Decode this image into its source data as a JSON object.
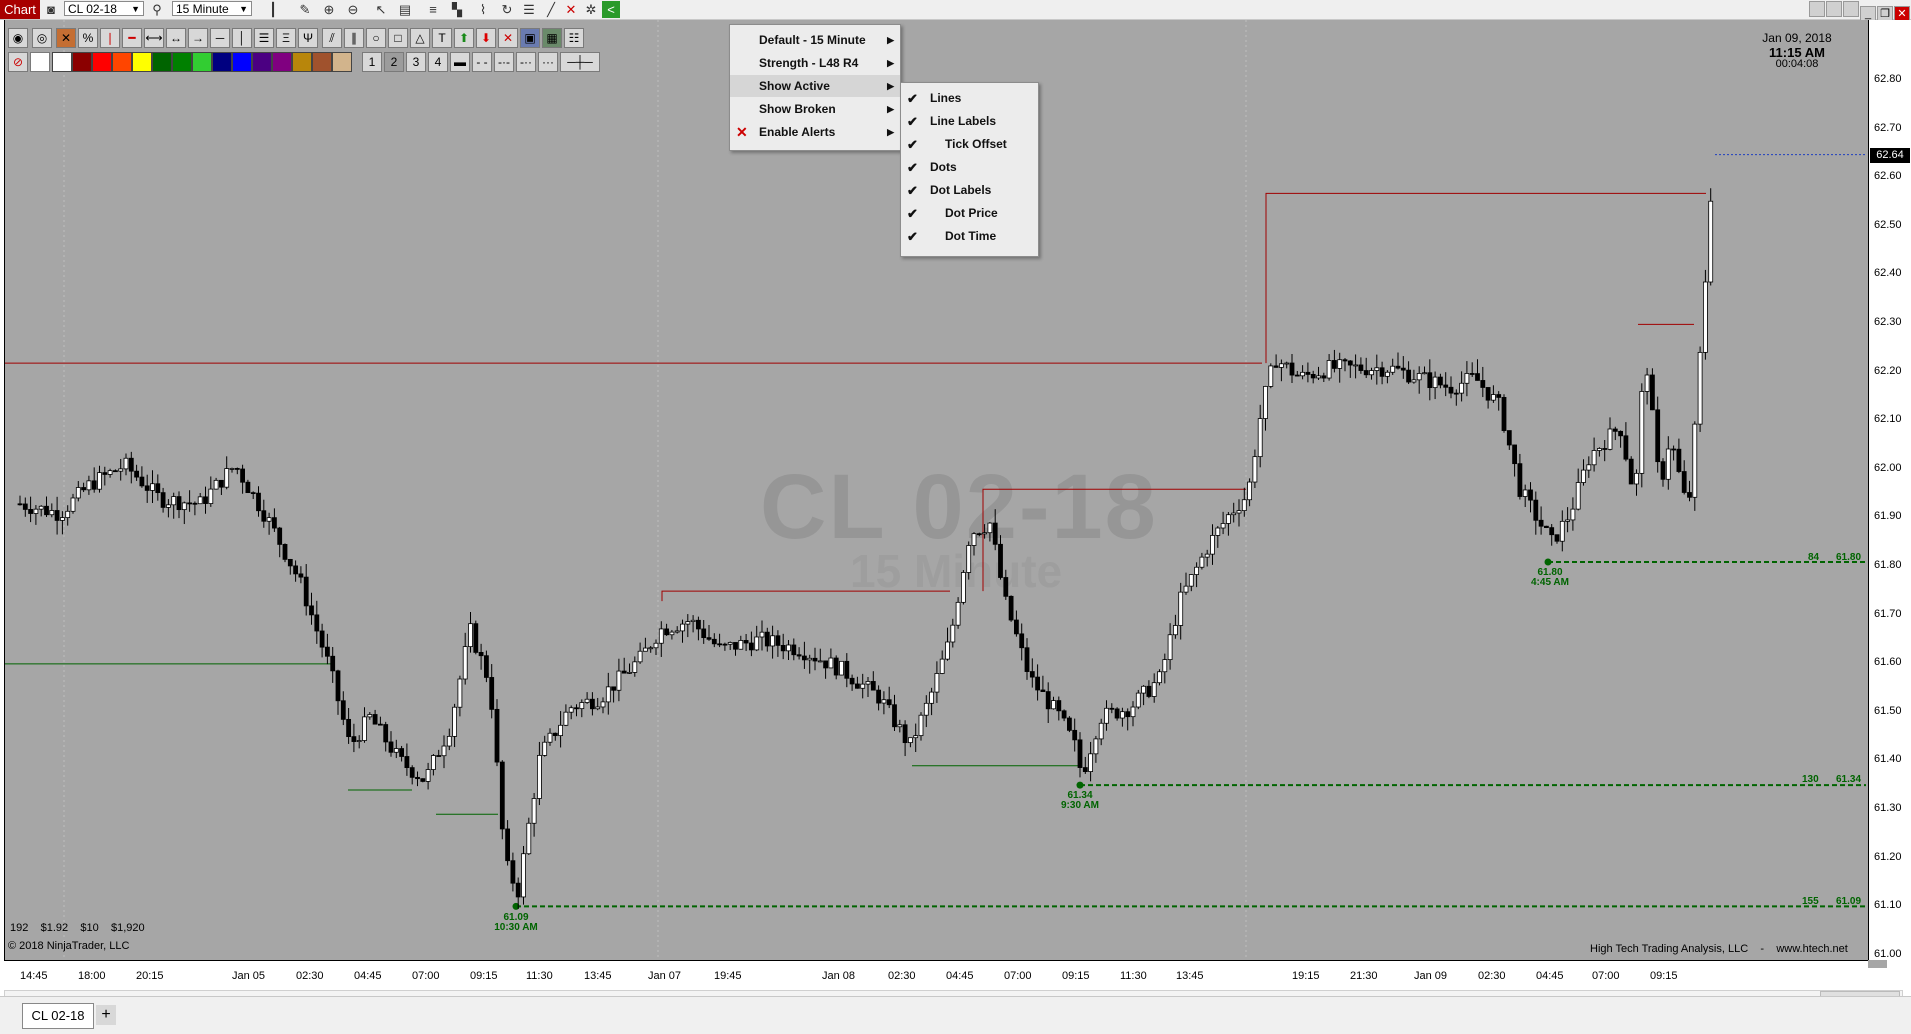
{
  "topbar": {
    "chart_tab": "Chart",
    "instrument": "CL 02-18",
    "interval": "15 Minute"
  },
  "header_time": {
    "date": "Jan 09, 2018",
    "time": "11:15 AM",
    "countdown": "00:04:08"
  },
  "watermark": {
    "instrument": "CL 02-18",
    "interval": "15 Minute"
  },
  "line_widths": [
    "1",
    "2",
    "3",
    "4"
  ],
  "colors": {
    "swatches": [
      "#ffffff",
      "#8b0000",
      "#ff0000",
      "#ff4500",
      "#ffff00",
      "#006400",
      "#008000",
      "#32cd32",
      "#000080",
      "#0000ff",
      "#4b0082",
      "#800080",
      "#b8860b",
      "#a0522d",
      "#d2b48c"
    ],
    "chart_bg": "#a6a6a6",
    "resistance": "#a00000",
    "support": "#006400"
  },
  "menu": {
    "items": [
      {
        "label": "Default   -   15 Minute",
        "submenu": true
      },
      {
        "label": "Strength   -   L48   R4",
        "submenu": true
      },
      {
        "label": "Show Active",
        "submenu": true,
        "highlighted": true
      },
      {
        "label": "Show Broken",
        "submenu": true
      },
      {
        "label": "Enable Alerts",
        "submenu": true,
        "disabled_mark": true
      }
    ]
  },
  "submenu": {
    "items": [
      {
        "label": "Lines",
        "checked": true,
        "indent": false
      },
      {
        "label": "Line Labels",
        "checked": true,
        "indent": false
      },
      {
        "label": "Tick Offset",
        "checked": true,
        "indent": true
      },
      {
        "label": "Dots",
        "checked": true,
        "indent": false
      },
      {
        "label": "Dot Labels",
        "checked": true,
        "indent": false
      },
      {
        "label": "Dot Price",
        "checked": true,
        "indent": true
      },
      {
        "label": "Dot Time",
        "checked": true,
        "indent": true
      }
    ]
  },
  "y_axis": {
    "ticks": [
      "62.80",
      "62.70",
      "62.60",
      "62.50",
      "62.40",
      "62.30",
      "62.20",
      "62.10",
      "62.00",
      "61.90",
      "61.80",
      "61.70",
      "61.60",
      "61.50",
      "61.40",
      "61.30",
      "61.20",
      "61.10",
      "61.00"
    ],
    "last_price": "62.64"
  },
  "x_axis": {
    "ticks": [
      "14:45",
      "18:00",
      "20:15",
      "Jan 05",
      "02:30",
      "04:45",
      "07:00",
      "09:15",
      "11:30",
      "13:45",
      "Jan 07",
      "19:45",
      "Jan 08",
      "02:30",
      "04:45",
      "07:00",
      "09:15",
      "11:30",
      "13:45",
      "19:15",
      "21:30",
      "Jan 09",
      "02:30",
      "04:45",
      "07:00",
      "09:15"
    ]
  },
  "chart_data": {
    "type": "candlestick",
    "instrument": "CL 02-18",
    "interval": "15 Minute",
    "y_range": [
      61.0,
      62.84
    ],
    "last_price": 62.64,
    "support_levels": [
      {
        "count": "84",
        "price": "61.80",
        "dot_label_price": "61.80",
        "dot_label_time": "4:45 AM"
      },
      {
        "count": "130",
        "price": "61.34",
        "dot_label_price": "61.34",
        "dot_label_time": "9:30 AM"
      },
      {
        "count": "155",
        "price": "61.09",
        "dot_label_price": "61.09",
        "dot_label_time": "10:30 AM"
      }
    ],
    "resistance_lines": [
      62.21,
      62.56,
      61.95,
      61.74,
      62.29
    ],
    "broken_support_lines": [
      61.59,
      61.33,
      61.28,
      61.38
    ]
  },
  "footer": {
    "stats": [
      "192",
      "$1.92",
      "$10",
      "$1,920"
    ],
    "copyright": "© 2018 NinjaTrader, LLC",
    "credit": "High Tech Trading Analysis, LLC",
    "credit_sep": "-",
    "credit_url": "www.htech.net"
  },
  "tabs": {
    "active": "CL 02-18",
    "add": "+"
  }
}
